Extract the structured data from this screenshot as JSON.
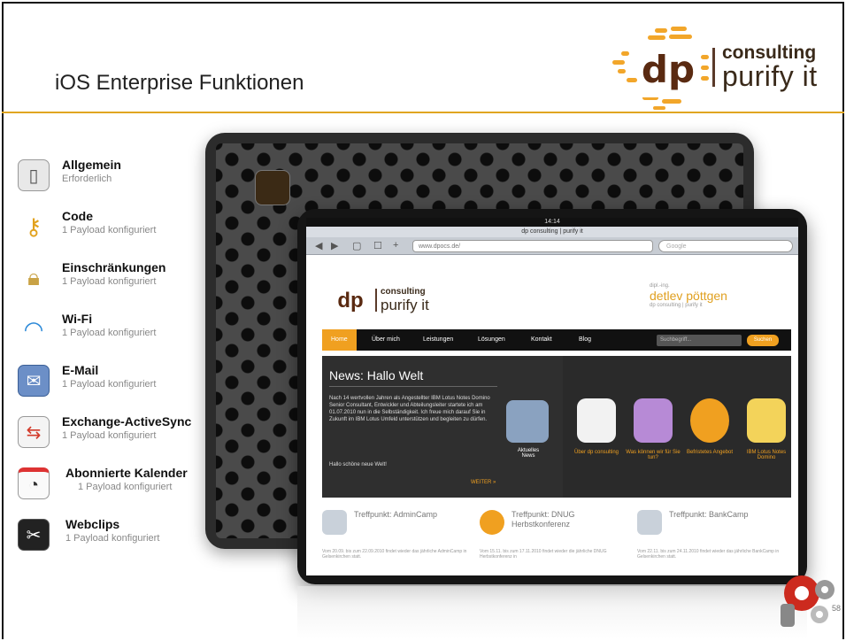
{
  "slide": {
    "title": "iOS Enterprise Funktionen",
    "page_number": "58",
    "accent_color": "#e0a520"
  },
  "logo": {
    "mark": "dp",
    "word1": "consulting",
    "word2": "purify it",
    "brand_color": "#f2a62a"
  },
  "settings": [
    {
      "name": "Allgemein",
      "sub": "Erforderlich",
      "icon": "lock-panel-icon"
    },
    {
      "name": "Code",
      "sub": "1 Payload konfiguriert",
      "icon": "key-icon"
    },
    {
      "name": "Einschränkungen",
      "sub": "1 Payload konfiguriert",
      "icon": "padlock-icon"
    },
    {
      "name": "Wi-Fi",
      "sub": "1 Payload konfiguriert",
      "icon": "wifi-icon"
    },
    {
      "name": "E-Mail",
      "sub": "1 Payload konfiguriert",
      "icon": "mail-icon"
    },
    {
      "name": "Exchange-ActiveSync",
      "sub": "1 Payload konfiguriert",
      "icon": "sync-icon"
    },
    {
      "name": "Abonnierte Kalender",
      "sub": "1 Payload konfiguriert",
      "icon": "calendar-icon"
    },
    {
      "name": "Webclips",
      "sub": "1 Payload konfiguriert",
      "icon": "webclip-icon"
    }
  ],
  "ipad": {
    "status_time": "14:14",
    "browser_title": "dp consulting | purify it",
    "url": "www.dpocs.de/",
    "search_placeholder": "Google",
    "site": {
      "logo_mark": "dp",
      "logo_word1": "consulting",
      "logo_word2": "purify it",
      "person_small": "dipl.-ing.",
      "person_name": "detlev pöttgen",
      "person_sub": "dp consulting | purify it",
      "nav": [
        "Home",
        "Über mich",
        "Leistungen",
        "Lösungen",
        "Kontakt",
        "Blog"
      ],
      "nav_search_placeholder": "Suchbegriff...",
      "nav_search_button": "Suchen",
      "news_title": "News: Hallo Welt",
      "news_body": "Nach 14 wertvollen Jahren als Angestellter IBM Lotus Notes Domino Senior Consultant, Entwickler und Abteilungsleiter startete ich am 01.07.2010 nun in die Selbständigkeit. Ich freue mich darauf Sie in Zukunft im IBM Lotus Umfeld unterstützen und begleiten zu dürfen.",
      "news_greeting": "Hallo schöne neue Welt!",
      "news_more": "WEITER »",
      "news_caption": "Aktuelles News",
      "tiles": [
        {
          "caption": "Über dp consulting",
          "color": "#f2f2f2"
        },
        {
          "caption": "Was können wir für Sie tun?",
          "color": "#b78ad6"
        },
        {
          "caption": "Befristetes Angebot",
          "color": "#f0a020"
        },
        {
          "caption": "IBM Lotus Notes Domino",
          "color": "#f3d35a"
        }
      ],
      "events": [
        {
          "title": "Treffpunkt: AdminCamp",
          "text": "Vom 20.09. bis zum 22.09.2010 findet wieder das jährliche AdminCamp in Gelsenkirchen statt."
        },
        {
          "title": "Treffpunkt: DNUG Herbstkonferenz",
          "text": "Vom 15.11. bis zum 17.11.2010 findet wieder die jährliche DNUG Herbstkonferenz in"
        },
        {
          "title": "Treffpunkt: BankCamp",
          "text": "Vom 22.11. bis zum 24.11.2010 findet wieder das jährliche BankCamp in Gelsenkirchen statt."
        }
      ]
    }
  }
}
